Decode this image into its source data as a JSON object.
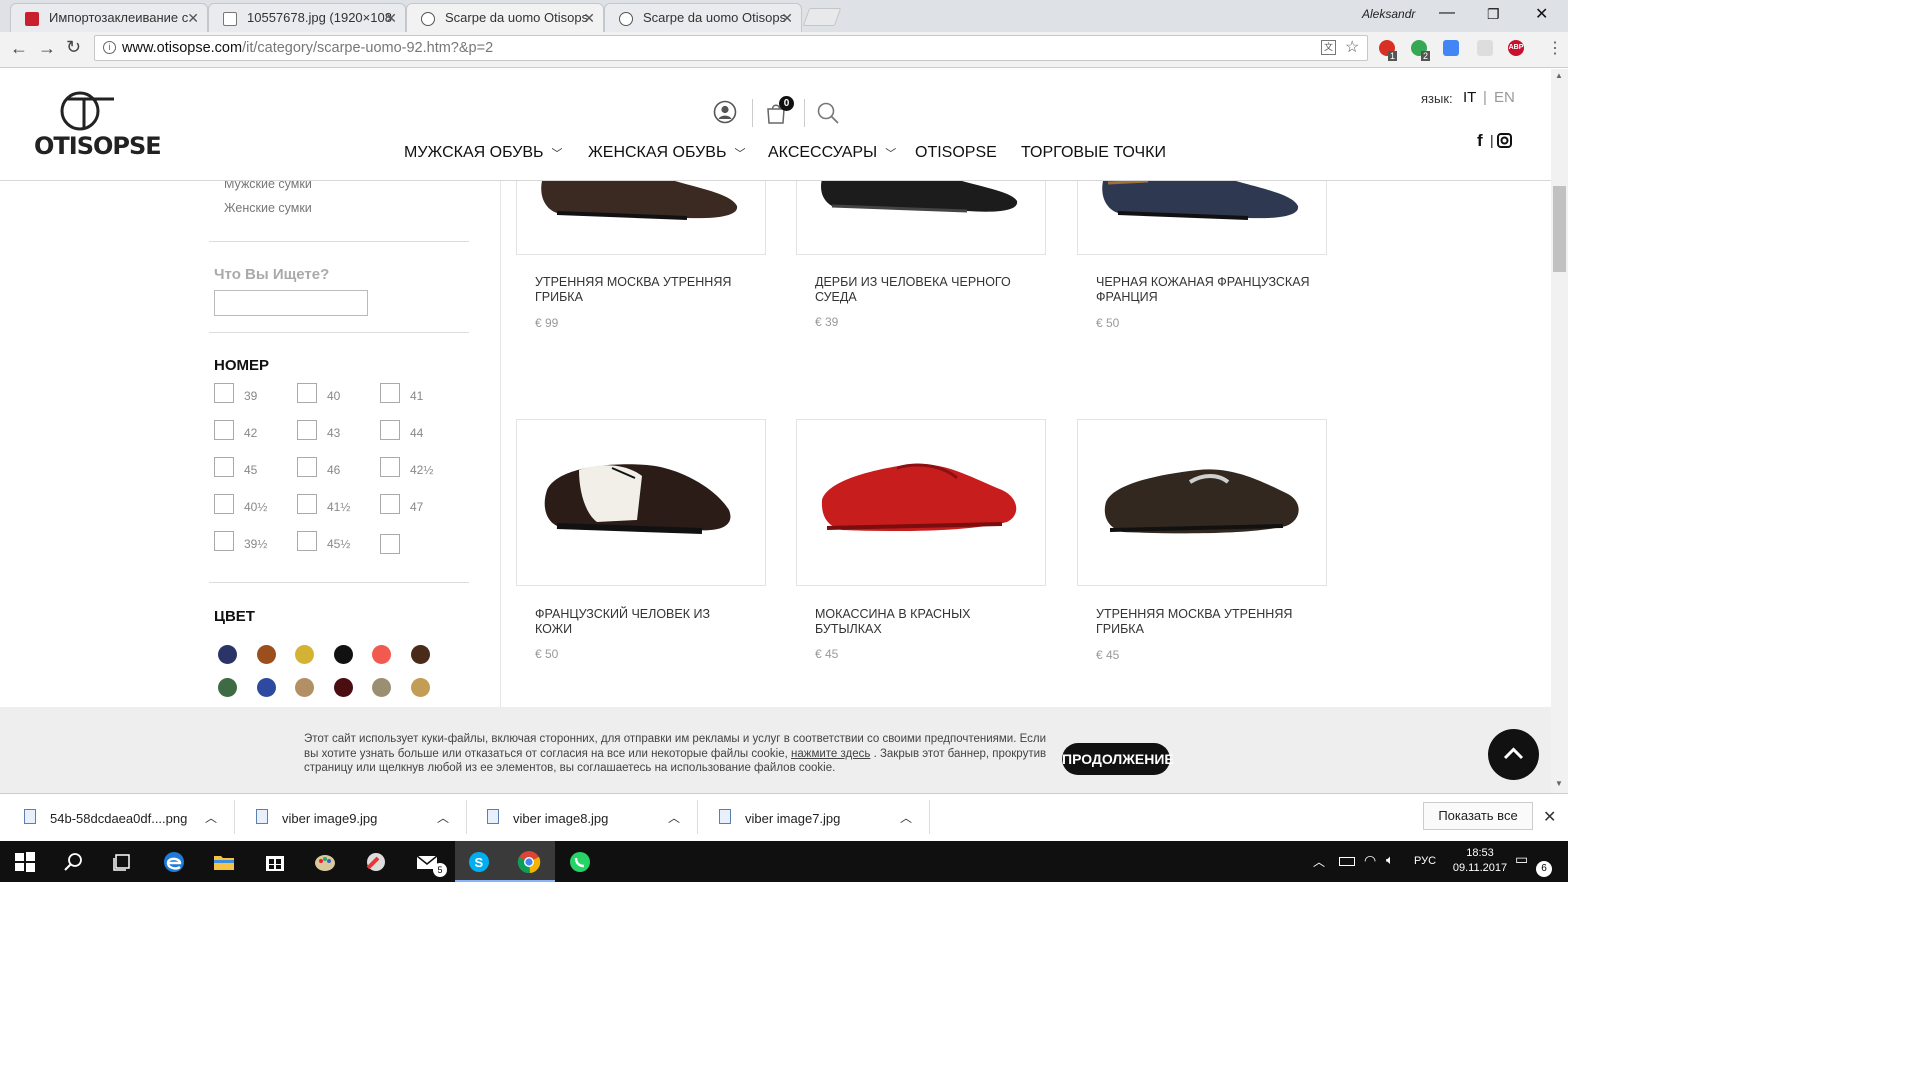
{
  "browser": {
    "tabs": [
      {
        "title": "Импортозаклеивание с"
      },
      {
        "title": "10557678.jpg (1920×108"
      },
      {
        "title": "Scarpe da uomo Otisops"
      },
      {
        "title": "Scarpe da uomo Otisops"
      }
    ],
    "user_name": "Aleksandr",
    "url_host": "www.otisopse.com",
    "url_path": "/it/category/scarpe-uomo-92.htm?&p=2",
    "extension_badges": [
      "1",
      "2"
    ],
    "abp_label": "ABP"
  },
  "site": {
    "logo_text": "OTISOPSE",
    "cart_count": "0",
    "nav": [
      {
        "label": "МУЖСКАЯ ОБУВЬ",
        "has_dropdown": true
      },
      {
        "label": "ЖЕНСКАЯ ОБУВЬ",
        "has_dropdown": true
      },
      {
        "label": "АКСЕССУАРЫ",
        "has_dropdown": true
      },
      {
        "label": "OTISOPSE",
        "has_dropdown": false
      },
      {
        "label": "ТОРГОВЫЕ ТОЧКИ",
        "has_dropdown": false
      }
    ],
    "lang_label": "язык:",
    "lang_it": "IT",
    "lang_sep": "|",
    "lang_en": "EN",
    "social_sep": "|"
  },
  "sidebar": {
    "links": [
      "Мужские сумки",
      "Женские сумки"
    ],
    "search_title": "Что Вы Ищете?",
    "search_value": "",
    "size_heading": "НОМЕР",
    "sizes": [
      "39",
      "40",
      "41",
      "42",
      "43",
      "44",
      "45",
      "46",
      "42½",
      "40½",
      "41½",
      "47",
      "39½",
      "45½",
      ""
    ],
    "color_heading": "ЦВЕТ",
    "colors": [
      "#2b3467",
      "#9a4f1c",
      "#d4b234",
      "#111111",
      "#f25a50",
      "#4a2a18",
      "#3e6b44",
      "#2e4aa0",
      "#b28f65",
      "#4a0d10",
      "#9b8f73",
      "#c39d55"
    ]
  },
  "products": [
    {
      "name": "УТРЕННЯЯ МОСКВА УТРЕННЯЯ ГРИБКА",
      "price": "€ 99",
      "shoe": "brown-suede-derby"
    },
    {
      "name": "ДЕРБИ ИЗ ЧЕЛОВЕКА ЧЕРНОГО СУЕДА",
      "price": "€ 39",
      "shoe": "black-suede-derby"
    },
    {
      "name": "ЧЕРНАЯ КОЖАНАЯ ФРАНЦУЗСКАЯ ФРАНЦИЯ",
      "price": "€ 50",
      "shoe": "navy-leather-shoe"
    },
    {
      "name": "ФРАНЦУЗСКИЙ ЧЕЛОВЕК ИЗ КОЖИ",
      "price": "€ 50",
      "shoe": "two-tone-brogue"
    },
    {
      "name": "МОКАССИНА В КРАСНЫХ БУТЫЛКАХ",
      "price": "€ 45",
      "shoe": "red-moccasin"
    },
    {
      "name": "УТРЕННЯЯ МОСКВА УТРЕННЯЯ ГРИБКА",
      "price": "€ 45",
      "shoe": "brown-horsebit-loafer"
    }
  ],
  "cookie": {
    "text_before": "Этот сайт использует куки-файлы, включая сторонних, для отправки им рекламы и услуг в соответствии со своими предпочтениями. Если вы хотите узнать больше или отказаться от согласия на все или некоторые файлы cookie, ",
    "link": "нажмите здесь",
    "text_after": " . Закрыв этот баннер, прокрутив страницу или щелкнув любой из ее элементов, вы соглашаетесь на использование файлов cookie.",
    "button": "ПРОДОЛЖЕНИЕ"
  },
  "downloads": {
    "items": [
      "54b-58dcdaea0df....png",
      "viber image9.jpg",
      "viber image8.jpg",
      "viber image7.jpg"
    ],
    "show_all": "Показать все"
  },
  "taskbar": {
    "lang": "РУС",
    "time": "18:53",
    "date": "09.11.2017",
    "mail_badge": "5",
    "notif_count": "6"
  }
}
